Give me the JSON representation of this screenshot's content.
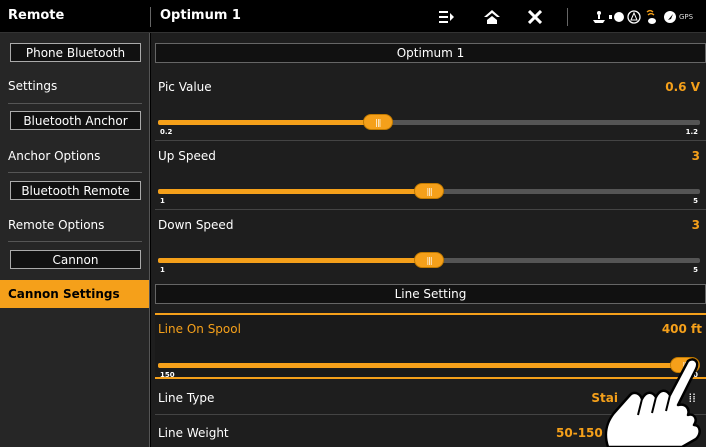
{
  "topbar": {
    "left_title": "Remote",
    "right_title": "Optimum 1",
    "icons": [
      "menu-icon",
      "home-icon",
      "close-icon",
      "boat-icon",
      "battery-icon",
      "compass-icon",
      "temperature-icon",
      "navigation-icon",
      "gps-icon"
    ],
    "gps_label": "GPS"
  },
  "sidebar": {
    "items": [
      {
        "label": "Phone Bluetooth",
        "kind": "button"
      },
      {
        "label": "Settings",
        "kind": "item"
      },
      {
        "label": "Bluetooth Anchor",
        "kind": "button"
      },
      {
        "label": "Anchor Options",
        "kind": "item"
      },
      {
        "label": "Bluetooth Remote",
        "kind": "button"
      },
      {
        "label": "Remote Options",
        "kind": "item"
      },
      {
        "label": "Cannon",
        "kind": "button"
      },
      {
        "label": "Cannon Settings",
        "kind": "item",
        "active": true
      }
    ]
  },
  "main": {
    "header": "Optimum 1",
    "pic_value": {
      "label": "Pic Value",
      "value": "0.6 V",
      "min": "0.2",
      "max": "1.2",
      "level": 0.4
    },
    "up_speed": {
      "label": "Up Speed",
      "value": "3",
      "min": "1",
      "max": "5",
      "level": 0.5
    },
    "down_speed": {
      "label": "Down Speed",
      "value": "3",
      "min": "1",
      "max": "5",
      "level": 0.5
    },
    "line_setting_header": "Line Setting",
    "line_on_spool": {
      "label": "Line On Spool",
      "value": "400 ft",
      "min": "150",
      "max": "400",
      "level": 1.0
    },
    "line_type": {
      "label": "Line Type",
      "value": "Stai"
    },
    "line_weight": {
      "label": "Line Weight",
      "value": "50-150 lb (27"
    }
  },
  "colors": {
    "accent": "#f5a01a",
    "background": "#1e1e1e",
    "sidebar": "#262626"
  }
}
